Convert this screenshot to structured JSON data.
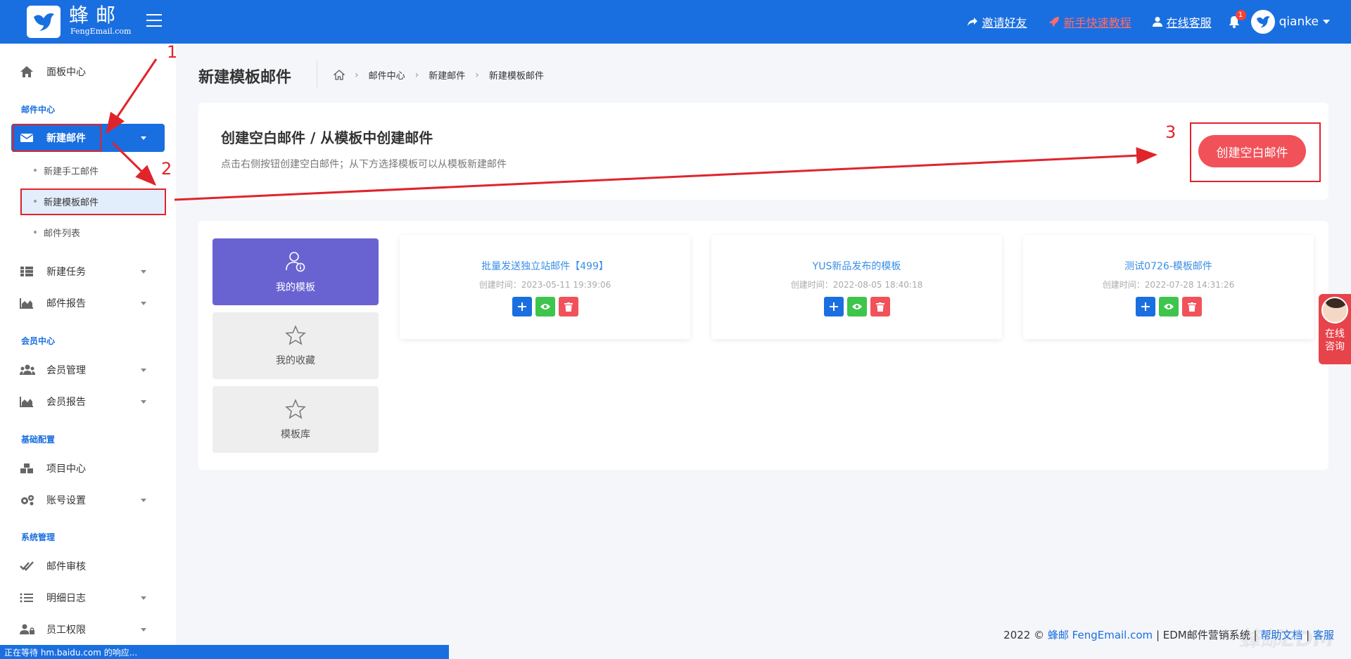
{
  "brand": {
    "name_cn": "蜂邮",
    "name_en": "FengEmail.com"
  },
  "topbar": {
    "invite": "邀请好友",
    "tutorial": "新手快速教程",
    "support": "在线客服",
    "notifications": "1",
    "username": "qianke"
  },
  "sidebar": {
    "dashboard": "面板中心",
    "group_mail": "邮件中心",
    "new_mail": "新建邮件",
    "sub_manual": "新建手工邮件",
    "sub_template": "新建模板邮件",
    "sub_list": "邮件列表",
    "new_task": "新建任务",
    "mail_report": "邮件报告",
    "group_member": "会员中心",
    "member_manage": "会员管理",
    "member_report": "会员报告",
    "group_basic": "基础配置",
    "project_center": "项目中心",
    "account_settings": "账号设置",
    "group_system": "系统管理",
    "mail_review": "邮件审核",
    "detail_log": "明细日志",
    "staff_perm": "员工权限"
  },
  "annotations": [
    "1",
    "2",
    "3"
  ],
  "header": {
    "page_title": "新建模板邮件",
    "breadcrumb": [
      "邮件中心",
      "新建邮件",
      "新建模板邮件"
    ]
  },
  "create": {
    "title": "创建空白邮件 / 从模板中创建邮件",
    "desc": "点击右侧按钮创建空白邮件；从下方选择模板可以从模板新建邮件",
    "button": "创建空白邮件"
  },
  "template_tabs": [
    "我的模板",
    "我的收藏",
    "模板库"
  ],
  "templates": [
    {
      "name": "批量发送独立站邮件【499】",
      "time": "创建时间：2023-05-11 19:39:06"
    },
    {
      "name": "YUS新品发布的模板",
      "time": "创建时间：2022-08-05 18:40:18"
    },
    {
      "name": "测试0726-模板邮件",
      "time": "创建时间：2022-07-28 14:31:26"
    }
  ],
  "footer": {
    "year": "2022 ©",
    "brand": "蜂邮 FengEmail.com",
    "system": "| EDM邮件营销系统 |",
    "help": "帮助文档",
    "divider": "|",
    "service": "客服",
    "watermark": "蜂邮EDM"
  },
  "status_bar": "正在等待 hm.baidu.com 的响应...",
  "online_widget": "在线咨询",
  "colors": {
    "primary": "#1a6fe0",
    "danger": "#f1525a",
    "purple": "#6963d2",
    "success": "#3ec54b",
    "annotation": "#e0242c"
  }
}
